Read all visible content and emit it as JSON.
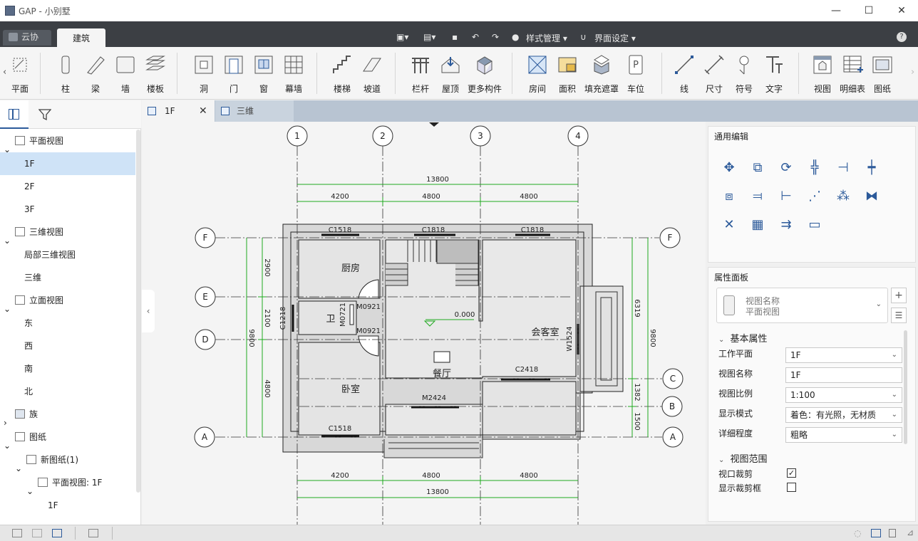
{
  "window": {
    "title": "GAP - 小别墅",
    "minimize": "—",
    "maximize": "☐",
    "close": "✕"
  },
  "ribbon_tabs": {
    "cloud": "云协同",
    "active": "建筑"
  },
  "quick_access": {
    "style_manage": "样式管理",
    "ui_settings": "界面设定"
  },
  "ribbon_tools": [
    {
      "label": "平面"
    },
    {
      "label": "柱"
    },
    {
      "label": "梁"
    },
    {
      "label": "墙"
    },
    {
      "label": "楼板"
    },
    {
      "label": "洞"
    },
    {
      "label": "门"
    },
    {
      "label": "窗"
    },
    {
      "label": "幕墙"
    },
    {
      "label": "楼梯"
    },
    {
      "label": "坡道"
    },
    {
      "label": "栏杆"
    },
    {
      "label": "屋顶"
    },
    {
      "label": "更多构件"
    },
    {
      "label": "房间"
    },
    {
      "label": "面积"
    },
    {
      "label": "填充遮罩"
    },
    {
      "label": "车位"
    },
    {
      "label": "线"
    },
    {
      "label": "尺寸"
    },
    {
      "label": "符号"
    },
    {
      "label": "文字"
    },
    {
      "label": "视图"
    },
    {
      "label": "明细表"
    },
    {
      "label": "图纸"
    }
  ],
  "tree": [
    {
      "label": "平面视图"
    },
    {
      "label": "1F"
    },
    {
      "label": "2F"
    },
    {
      "label": "3F"
    },
    {
      "label": "三维视图"
    },
    {
      "label": "局部三维视图"
    },
    {
      "label": "三维"
    },
    {
      "label": "立面视图"
    },
    {
      "label": "东"
    },
    {
      "label": "西"
    },
    {
      "label": "南"
    },
    {
      "label": "北"
    },
    {
      "label": "族"
    },
    {
      "label": "图纸"
    },
    {
      "label": "新图纸(1)"
    },
    {
      "label": "平面视图: 1F"
    },
    {
      "label": "1F"
    }
  ],
  "doc_tabs": [
    {
      "label": "1F"
    },
    {
      "label": "三维"
    }
  ],
  "plan": {
    "axes_v": [
      "1",
      "2",
      "3",
      "4"
    ],
    "axes_h": [
      "F",
      "E",
      "D",
      "C",
      "B",
      "A"
    ],
    "dims_top": {
      "total": "13800",
      "segs": [
        "4200",
        "4800",
        "4800"
      ]
    },
    "dims_bottom": {
      "total": "13800",
      "segs": [
        "4200",
        "4800",
        "4800"
      ]
    },
    "dims_left": {
      "segs": [
        "2900",
        "2100",
        "4800"
      ],
      "total": "9800"
    },
    "dims_right": {
      "segs": [
        "6319",
        "1382",
        "1500"
      ],
      "total": "9800"
    },
    "rooms": {
      "kitchen": "厨房",
      "toilet": "卫",
      "living": "会客室",
      "dining": "餐厅",
      "bedroom": "卧室"
    },
    "tags": {
      "c1518_a": "C1518",
      "c1818_a": "C1818",
      "c1818_b": "C1818",
      "m0921_a": "M0921",
      "m0921_b": "M0921",
      "m0721": "M0721",
      "c1218": "C1218",
      "level": "0.000",
      "w1524": "W1524",
      "c2418": "C2418",
      "m2424": "M2424",
      "c1518_b": "C1518"
    }
  },
  "right_panel": {
    "edit_title": "通用编辑",
    "prop_title": "属性面板",
    "view_type": {
      "name_label": "视图名称",
      "name_value": "平面视图"
    },
    "basic_section": "基本属性",
    "props": [
      {
        "label": "工作平面",
        "value": "1F",
        "dropdown": true
      },
      {
        "label": "视图名称",
        "value": "1F",
        "dropdown": false
      },
      {
        "label": "视图比例",
        "value": "1:100",
        "dropdown": true
      },
      {
        "label": "显示模式",
        "value": "着色：有光照，无材质",
        "dropdown": true
      },
      {
        "label": "详细程度",
        "value": "粗略",
        "dropdown": true
      }
    ],
    "range_section": "视图范围",
    "checks": [
      {
        "label": "视口裁剪",
        "checked": true,
        "mark": "✓"
      },
      {
        "label": "显示裁剪框",
        "checked": false,
        "mark": ""
      }
    ]
  },
  "colors": {
    "accent": "#2c5a9a",
    "dim_green": "#1faa1f",
    "titlebar_dark": "#3c3f44",
    "tab_selected": "#cfe3f7"
  }
}
